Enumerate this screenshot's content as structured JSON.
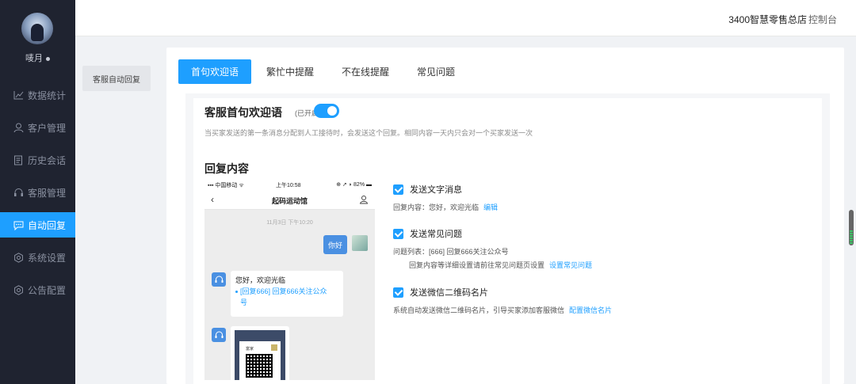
{
  "sidebar": {
    "username": "唛月",
    "items": [
      {
        "label": "数据统计",
        "icon": "line-chart-icon"
      },
      {
        "label": "客户管理",
        "icon": "user-icon"
      },
      {
        "label": "历史会话",
        "icon": "document-icon"
      },
      {
        "label": "客服管理",
        "icon": "headset-icon"
      },
      {
        "label": "自动回复",
        "icon": "chat-icon",
        "active": true
      },
      {
        "label": "系统设置",
        "icon": "gear-icon"
      },
      {
        "label": "公告配置",
        "icon": "gear-icon"
      }
    ]
  },
  "topbar": {
    "store_name": "3400智慧零售总店",
    "separator": "|",
    "console": "控制台"
  },
  "submenu": {
    "item": "客服自动回复"
  },
  "tabs": [
    "首句欢迎语",
    "繁忙中提醒",
    "不在线提醒",
    "常见问题"
  ],
  "welcome": {
    "title": "客服首句欢迎语",
    "status": "(已开启)",
    "toggle_on": true,
    "description": "当买家发送的第一条消息分配到人工接待时，会发送这个回复。相同内容一天内只会对一个买家发送一次",
    "section_title": "回复内容"
  },
  "phone": {
    "carrier": "中国移动",
    "time": "上午10:58",
    "battery": "82%",
    "chat_name": "起码运动馆",
    "chat_time": "11月3日 下午10:20",
    "user_msg": "你好",
    "bot_greeting": "您好，欢迎光临",
    "bot_question_1": "[回复666] 回复666关注公众",
    "bot_question_2": "号",
    "qr_text": "富家"
  },
  "options": {
    "text_msg": {
      "label": "发送文字消息",
      "content_label": "回复内容：您好，欢迎光临",
      "link": "编辑"
    },
    "faq": {
      "label": "发送常见问题",
      "list": "问题列表：[666] 回复666关注公众号",
      "hint": "回复内容等详细设置请前往常见问题页设置",
      "link": "设置常见问题"
    },
    "qr": {
      "label": "发送微信二维码名片",
      "hint": "系统自动发送微信二维码名片，引导买家添加客服微信",
      "link": "配置微信名片"
    }
  }
}
